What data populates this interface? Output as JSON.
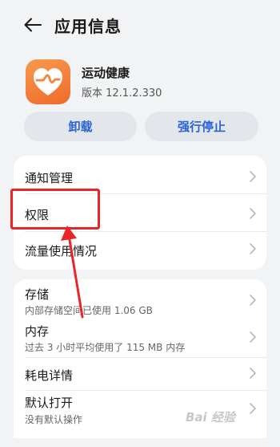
{
  "header": {
    "title": "应用信息",
    "back_icon": "arrow-left-icon"
  },
  "app": {
    "name": "运动健康",
    "version": "版本 12.1.2.330",
    "icon": "heart-pulse-icon",
    "icon_colors": [
      "#f79a4c",
      "#ef6a2c"
    ]
  },
  "actions": {
    "uninstall_label": "卸载",
    "force_stop_label": "强行停止"
  },
  "card1": {
    "items": [
      {
        "label": "通知管理"
      },
      {
        "label": "权限"
      },
      {
        "label": "流量使用情况"
      }
    ]
  },
  "card2": {
    "items": [
      {
        "label": "存储",
        "sub": "内部存储空间已使用 1.06 GB"
      },
      {
        "label": "内存",
        "sub": "过去 3 小时平均使用了 115 MB 内存"
      },
      {
        "label": "耗电详情"
      },
      {
        "label": "默认打开",
        "sub": "没有默认操作"
      }
    ]
  },
  "annotation": {
    "color": "#e8262a"
  },
  "watermark": {
    "text": "Bai 经验"
  },
  "colors": {
    "accent": "#2b63d6",
    "background": "#f1f3f5",
    "button_bg": "#e3e6ea"
  }
}
